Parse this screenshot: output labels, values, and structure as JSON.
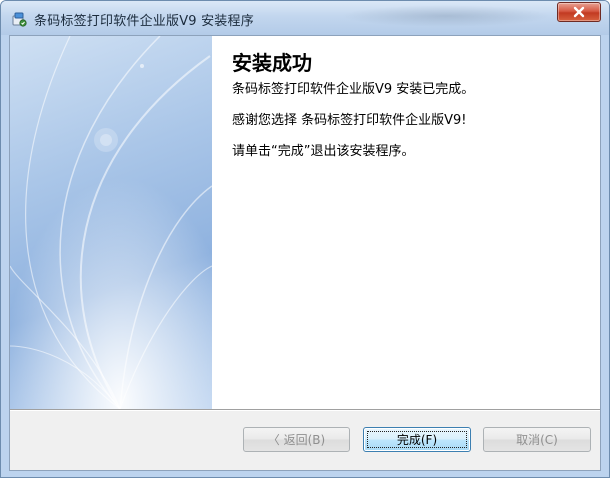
{
  "window": {
    "title": "条码标签打印软件企业版V9 安装程序",
    "close_label": "X"
  },
  "content": {
    "heading": "安装成功",
    "lines": [
      "条码标签打印软件企业版V9  安装已完成。",
      "感谢您选择 条码标签打印软件企业版V9!",
      "请单击“完成”退出该安装程序。"
    ]
  },
  "buttons": {
    "back": "〈 返回(B)",
    "finish": "完成(F)",
    "cancel": "取消(C)"
  },
  "colors": {
    "side_panel": "#9dbbe3",
    "close_button": "#c9452b",
    "focused_button_border": "#3c7fb1"
  },
  "icons": {
    "app": "installer-app-icon",
    "close": "close-icon"
  }
}
